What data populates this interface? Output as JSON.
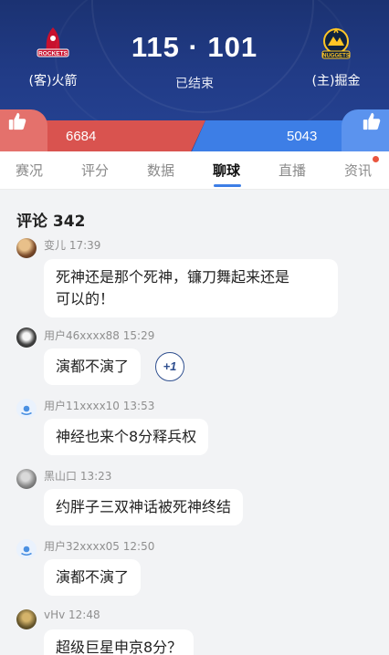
{
  "match": {
    "away_team": "(客)火箭",
    "home_team": "(主)掘金",
    "score": "115 · 101",
    "status": "已结束",
    "away_logo": "rockets-logo",
    "home_logo": "nuggets-logo"
  },
  "likes": {
    "away_count": "6684",
    "home_count": "5043",
    "away_color": "#d9534f",
    "home_color": "#3d7ee6"
  },
  "tabs": [
    {
      "label": "赛况",
      "active": false
    },
    {
      "label": "评分",
      "active": false
    },
    {
      "label": "数据",
      "active": false
    },
    {
      "label": "聊球",
      "active": true
    },
    {
      "label": "直播",
      "active": false
    },
    {
      "label": "资讯",
      "active": false,
      "badge_dot": true
    }
  ],
  "comments_header": "评论 342",
  "comments": [
    {
      "user": "变儿 17:39",
      "text_lines": [
        "死神还是那个死神，镰刀舞起来还是",
        "可以的！"
      ],
      "avatar": "photo-avatar"
    },
    {
      "user": "用户46xxxx88 15:29",
      "text_lines": [
        "演都不演了"
      ],
      "avatar": "photo-avatar",
      "plus_one": "+1"
    },
    {
      "user": "用户11xxxx10 13:53",
      "text_lines": [
        "神经也来个8分释兵权"
      ],
      "avatar": "default-avatar"
    },
    {
      "user": "黑山口 13:23",
      "text_lines": [
        "约胖子三双神话被死神终结"
      ],
      "avatar": "photo-avatar"
    },
    {
      "user": "用户32xxxx05 12:50",
      "text_lines": [
        "演都不演了"
      ],
      "avatar": "default-avatar"
    },
    {
      "user": "vHv 12:48",
      "text_lines": [
        "超级巨星申京8分？"
      ],
      "avatar": "photo-avatar"
    }
  ]
}
